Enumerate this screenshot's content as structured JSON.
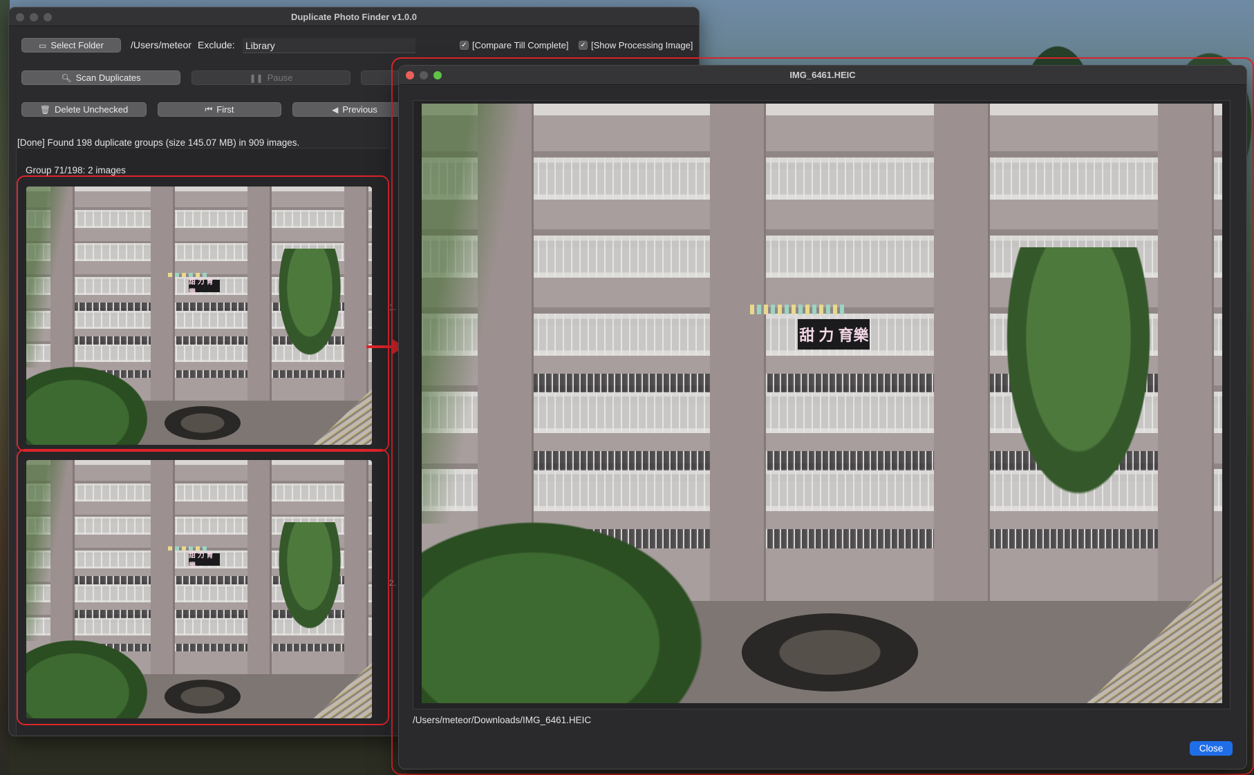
{
  "main_window": {
    "title": "Duplicate Photo Finder v1.0.0",
    "toolbar": {
      "select_folder_label": "Select Folder",
      "folder_path": "/Users/meteor",
      "exclude_label": "Exclude:",
      "exclude_value": "Library",
      "compare_till_complete_label": "[Compare Till Complete]",
      "compare_till_complete_checked": true,
      "show_processing_image_label": "[Show Processing Image]",
      "show_processing_image_checked": true,
      "scan_duplicates_label": "Scan Duplicates",
      "pause_label": "Pause",
      "delete_unchecked_label": "Delete Unchecked",
      "first_label": "First",
      "previous_label": "Previous"
    },
    "status": "[Done] Found 198 duplicate groups (size 145.07 MB) in 909 images.",
    "group": {
      "label": "Group 71/198: 2 images",
      "items": [
        {
          "index_label": "1."
        },
        {
          "index_label": "2."
        }
      ]
    }
  },
  "image_text": {
    "banner": "甜 力 育樂"
  },
  "preview_window": {
    "title": "IMG_6461.HEIC",
    "file_path": "/Users/meteor/Downloads/IMG_6461.HEIC",
    "close_label": "Close"
  },
  "colors": {
    "annotation_red": "#e0242a",
    "accent_blue": "#1f6ee8"
  },
  "icons": {
    "select_folder": "folder-icon",
    "scan": "magnifier-icon",
    "pause": "pause-icon",
    "delete": "trash-icon",
    "first": "skip-to-start-icon",
    "previous": "previous-triangle-icon"
  }
}
